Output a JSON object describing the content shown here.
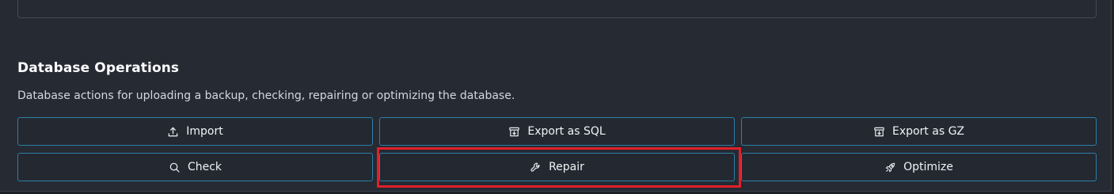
{
  "section": {
    "title": "Database Operations",
    "description": "Database actions for uploading a backup, checking, repairing or optimizing the database."
  },
  "operations": [
    {
      "label": "Import",
      "icon": "upload-icon"
    },
    {
      "label": "Export as SQL",
      "icon": "archive-download-icon"
    },
    {
      "label": "Export as GZ",
      "icon": "archive-download-icon"
    },
    {
      "label": "Check",
      "icon": "search-icon"
    },
    {
      "label": "Repair",
      "icon": "wrench-icon"
    },
    {
      "label": "Optimize",
      "icon": "rocket-icon"
    }
  ],
  "highlight": {
    "target": "Repair",
    "color": "#e0202a"
  },
  "colors": {
    "accent_border": "#2b7fa8",
    "panel_bg": "#262a33",
    "text": "#f1f3f6"
  }
}
